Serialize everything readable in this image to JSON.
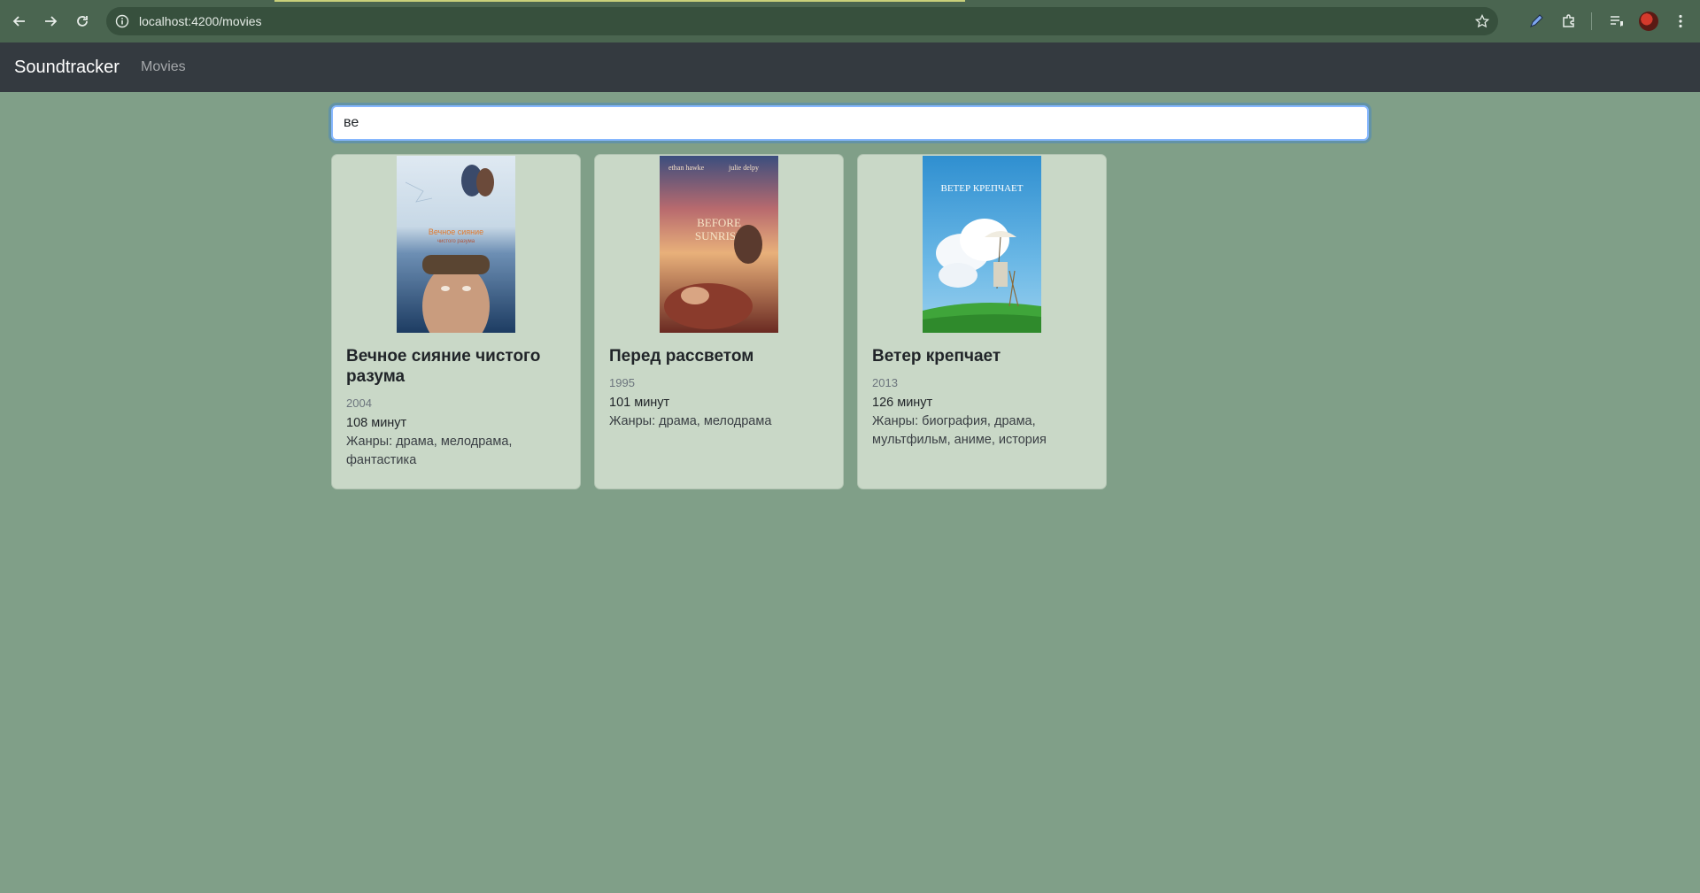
{
  "browser": {
    "url": "localhost:4200/movies",
    "icons": [
      "back-icon",
      "forward-icon",
      "reload-icon",
      "site-info-icon",
      "bookmark-star-icon",
      "pen-extension-icon",
      "extensions-puzzle-icon",
      "reading-list-icon",
      "profile-avatar",
      "kebab-menu-icon"
    ]
  },
  "navbar": {
    "brand": "Soundtracker",
    "links": [
      "Movies"
    ]
  },
  "search": {
    "value": "ве"
  },
  "movies": [
    {
      "title": "Вечное сияние чистого разума",
      "year": "2004",
      "duration": "108 минут",
      "genres": "Жанры: драма, мелодрама, фантастика",
      "poster_text": "Вечное сияние чистого разума"
    },
    {
      "title": "Перед рассветом",
      "year": "1995",
      "duration": "101 минут",
      "genres": "Жанры: драма, мелодрама",
      "poster_text": "BEFORE SUNRISE"
    },
    {
      "title": "Ветер крепчает",
      "year": "2013",
      "duration": "126 минут",
      "genres": "Жанры: биография, драма, мультфильм, аниме, история",
      "poster_text": "ВЕТЕР КРЕПЧАЕТ"
    }
  ]
}
